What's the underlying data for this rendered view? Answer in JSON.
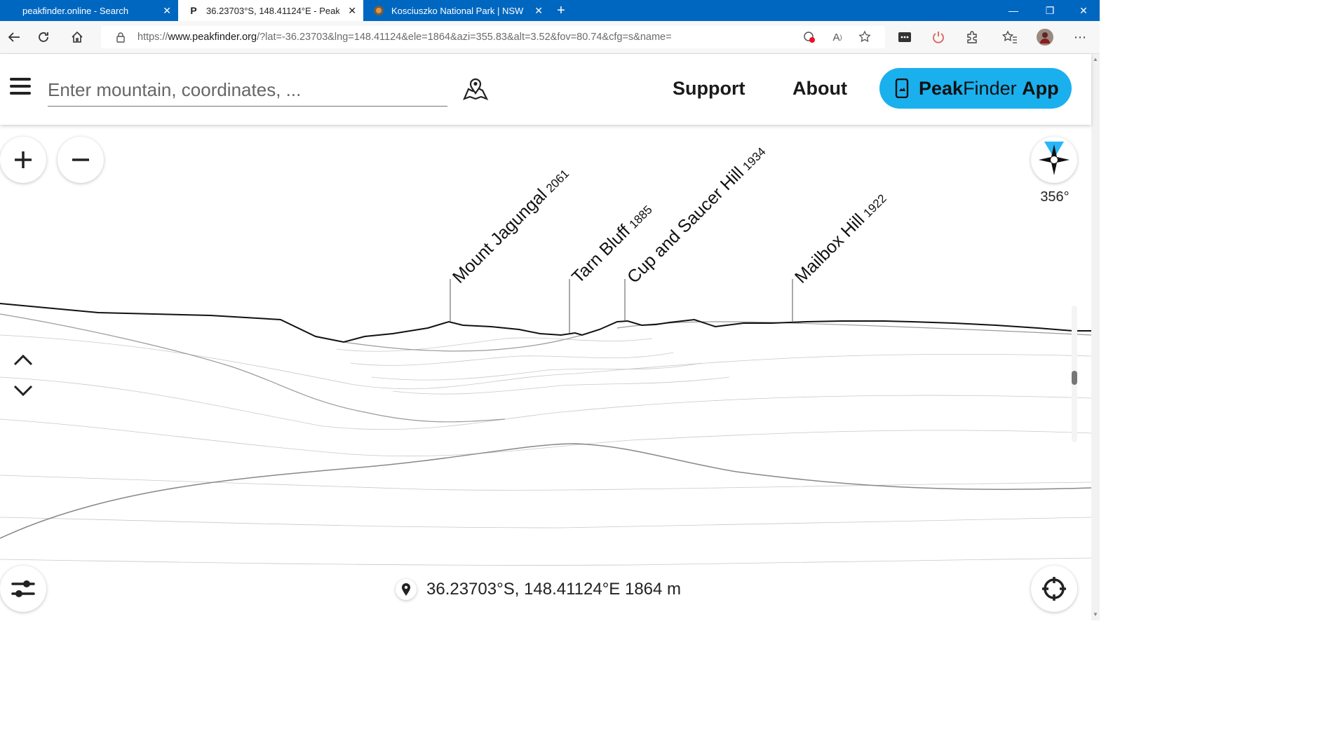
{
  "browser": {
    "tabs": [
      {
        "title": "peakfinder.online - Search",
        "favicon": "search-favicon",
        "active": false
      },
      {
        "title": "36.23703°S, 148.41124°E - PeakF",
        "favicon": "P",
        "active": true
      },
      {
        "title": "Kosciuszko National Park | NSW",
        "favicon": "park-favicon",
        "active": false
      }
    ],
    "url": {
      "prefix": "https://",
      "host": "www.peakfinder.org",
      "path": "/?lat=-36.23703&lng=148.41124&ele=1864&azi=355.83&alt=3.52&fov=80.74&cfg=s&name="
    }
  },
  "site": {
    "search_placeholder": "Enter mountain, coordinates, ...",
    "nav": {
      "support": "Support",
      "about": "About"
    },
    "app_button": {
      "brand_bold": "Peak",
      "brand_rest": "Finder",
      "suffix": "App"
    }
  },
  "view": {
    "heading": "356°",
    "location": "36.23703°S, 148.41124°E 1864 m",
    "peaks": [
      {
        "name": "Mount Jagungal",
        "elevation": "2061"
      },
      {
        "name": "Tarn Bluff",
        "elevation": "1885"
      },
      {
        "name": "Cup and Saucer Hill",
        "elevation": "1934"
      },
      {
        "name": "Mailbox Hill",
        "elevation": "1922"
      }
    ]
  },
  "colors": {
    "tabbar": "#0067c0",
    "app_button": "#1ab0ee",
    "compass_beam": "#29b6f6"
  }
}
